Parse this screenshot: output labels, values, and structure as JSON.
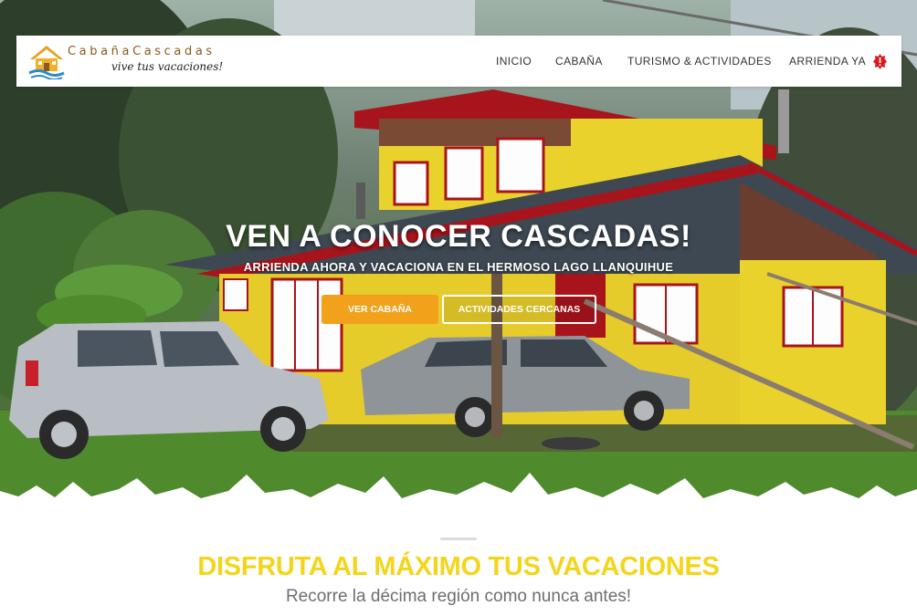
{
  "brand": {
    "name": "CabañaCascadas",
    "tagline": "vive tus vacaciones!"
  },
  "nav": {
    "items": [
      {
        "label": "INICIO"
      },
      {
        "label": "CABAÑA"
      },
      {
        "label": "TURISMO & ACTIVIDADES"
      },
      {
        "label": "ARRIENDA YA"
      }
    ],
    "badge_icon": "exclamation-icon"
  },
  "hero": {
    "title": "VEN A CONOCER CASCADAS!",
    "subtitle": "ARRIENDA AHORA Y VACACIONA EN EL HERMOSO LAGO LLANQUIHUE",
    "primary_button": "VER CABAÑA",
    "secondary_button": "ACTIVIDADES CERCANAS"
  },
  "section": {
    "title": "DISFRUTA AL MÁXIMO TUS VACACIONES",
    "subtitle": "Recorre la décima región como nunca antes!"
  },
  "colors": {
    "accent_orange": "#f2a11b",
    "title_yellow": "#f3d51b",
    "badge_red": "#e0161b",
    "house_yellow": "#e9d22c",
    "roof_red": "#a8141c"
  }
}
